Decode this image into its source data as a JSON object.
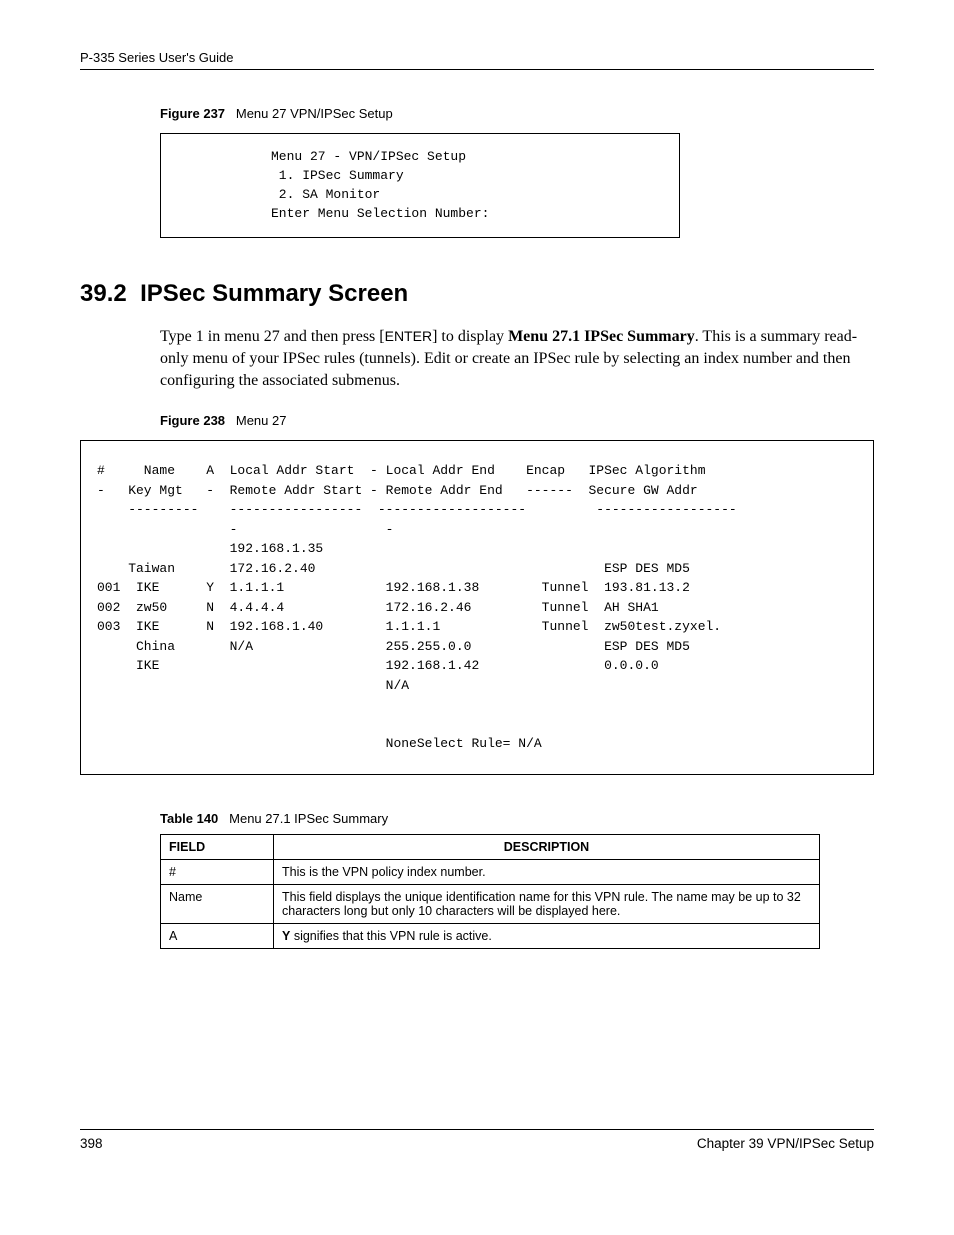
{
  "header": {
    "guide_title": "P-335 Series User's Guide"
  },
  "figure237": {
    "caption_label": "Figure 237",
    "caption_text": "Menu 27 VPN/IPSec Setup",
    "content": "Menu 27 - VPN/IPSec Setup\n 1. IPSec Summary\n 2. SA Monitor\nEnter Menu Selection Number:"
  },
  "section": {
    "number": "39.2",
    "title": "IPSec Summary Screen",
    "paragraph_pre": "Type 1 in menu 27 and then press [",
    "paragraph_key": "ENTER",
    "paragraph_mid": "] to display ",
    "paragraph_bold": "Menu 27.1 IPSec Summary",
    "paragraph_post": ". This is a summary read-only menu of your IPSec rules (tunnels). Edit or create an IPSec rule by selecting an index number and then configuring the associated submenus."
  },
  "figure238": {
    "caption_label": "Figure 238",
    "caption_text": "Menu 27",
    "content": "#     Name    A  Local Addr Start  - Local Addr End    Encap   IPSec Algorithm\n-   Key Mgt   -  Remote Addr Start - Remote Addr End   ------  Secure GW Addr\n    ---------    -----------------  -------------------         ------------------\n                 -                   -\n                 192.168.1.35\n    Taiwan       172.16.2.40                                     ESP DES MD5\n001  IKE      Y  1.1.1.1             192.168.1.38        Tunnel  193.81.13.2\n002  zw50     N  4.4.4.4             172.16.2.46         Tunnel  AH SHA1\n003  IKE      N  192.168.1.40        1.1.1.1             Tunnel  zw50test.zyxel.\n     China       N/A                 255.255.0.0                 ESP DES MD5\n     IKE                             192.168.1.42                0.0.0.0\n                                     N/A\n\n\n                                     NoneSelect Rule= N/A"
  },
  "table140": {
    "caption_label": "Table 140",
    "caption_text": "Menu 27.1 IPSec Summary",
    "header_field": "FIELD",
    "header_desc": "DESCRIPTION",
    "rows": [
      {
        "field": "#",
        "desc": "This is the VPN policy index number."
      },
      {
        "field": "Name",
        "desc": "This field displays the unique identification name for this VPN rule. The name may be up to 32 characters long but only 10 characters will be displayed here."
      },
      {
        "field": "A",
        "desc_bold": "Y",
        "desc_rest": " signifies that this VPN rule is active."
      }
    ]
  },
  "footer": {
    "page_number": "398",
    "chapter": "Chapter 39 VPN/IPSec Setup"
  }
}
